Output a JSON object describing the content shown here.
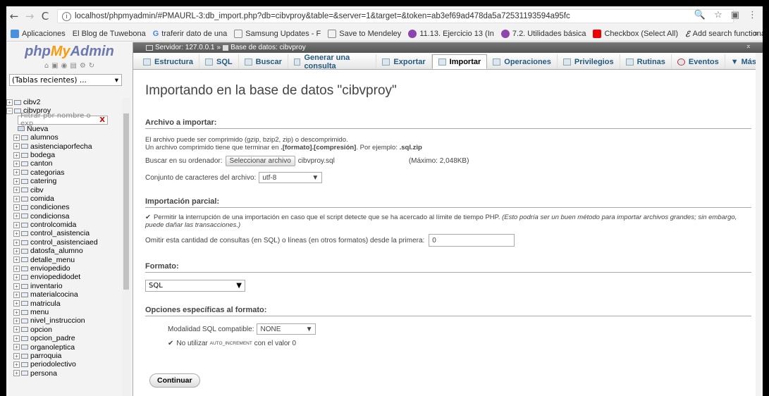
{
  "browser": {
    "url": "localhost/phpmyadmin/#PMAURL-3:db_import.php?db=cibvproy&table=&server=1&target=&token=ab3ef69ad478da5a72531193594a95fc",
    "bookmarks": [
      "Aplicaciones",
      "El Blog de Tuwebona",
      "traferir dato de una",
      "Samsung Updates - F",
      "Save to Mendeley",
      "11.13. Ejercicio 13 (In",
      "7.2. Utilidades básica",
      "Checkbox (Select All)",
      "Add search functiona"
    ],
    "more": "»"
  },
  "logo": {
    "php": "php",
    "my": "My",
    "admin": "Admin"
  },
  "left": {
    "recent": "(Tablas recientes) ...",
    "dbs": [
      "cibv2",
      "cibvproy"
    ],
    "filter_placeholder": "Filtrar por nombre o exp",
    "filter_clear": "X",
    "new_label": "Nueva",
    "tables": [
      "alumnos",
      "asistenciaporfecha",
      "bodega",
      "canton",
      "categorias",
      "catering",
      "cibv",
      "comida",
      "condiciones",
      "condicionsa",
      "controlcomida",
      "control_asistencia",
      "control_asistenciaed",
      "datosfa_alumno",
      "detalle_menu",
      "enviopedido",
      "enviopedidodet",
      "inventario",
      "materialcocina",
      "matricula",
      "menu",
      "nivel_instruccion",
      "opcion",
      "opcion_padre",
      "organoleptica",
      "parroquia",
      "periodolectivo",
      "persona"
    ]
  },
  "breadcrumb": {
    "server": "Servidor: 127.0.0.1",
    "sep": "»",
    "db": "Base de datos: cibvproy"
  },
  "tabs": [
    "Estructura",
    "SQL",
    "Buscar",
    "Generar una consulta",
    "Exportar",
    "Importar",
    "Operaciones",
    "Privilegios",
    "Rutinas",
    "Eventos",
    "Más"
  ],
  "main": {
    "title": "Importando en la base de datos \"cibvproy\"",
    "file_section": "Archivo a importar:",
    "compress_l1": "El archivo puede ser comprimido (gzip, bzip2, zip) o descomprimido.",
    "compress_l2a": "Un archivo comprimido tiene que terminar en ",
    "compress_l2b": ".[formato].[compresión]",
    "compress_l2c": ". Por ejemplo: ",
    "compress_l2d": ".sql.zip",
    "browse_label": "Buscar en su ordenador:",
    "browse_button": "Seleccionar archivo",
    "file_name": "cibvproy.sql",
    "max_size": "(Máximo: 2,048KB)",
    "charset_label": "Conjunto de caracteres del archivo:",
    "charset_value": "utf-8",
    "partial_section": "Importación parcial:",
    "partial_text": "Permitir la interrupción de una importación en caso que el script detecte que se ha acercado al límite de tiempo PHP.",
    "partial_note": "(Esto podría ser un buen método para importar archivos grandes; sin embargo, puede dañar las transacciones.)",
    "skip_label": "Omitir esta cantidad de consultas (en SQL) o líneas (en otros formatos) desde la primera:",
    "skip_value": "0",
    "format_section": "Formato:",
    "format_value": "SQL",
    "options_section": "Opciones específicas al formato:",
    "sqlmode_label": "Modalidad SQL compatible:",
    "sqlmode_value": "NONE",
    "autoinc_pre": "No utilizar ",
    "autoinc_code": "AUTO_INCREMENT",
    "autoinc_post": " con el valor 0",
    "submit": "Continuar"
  }
}
